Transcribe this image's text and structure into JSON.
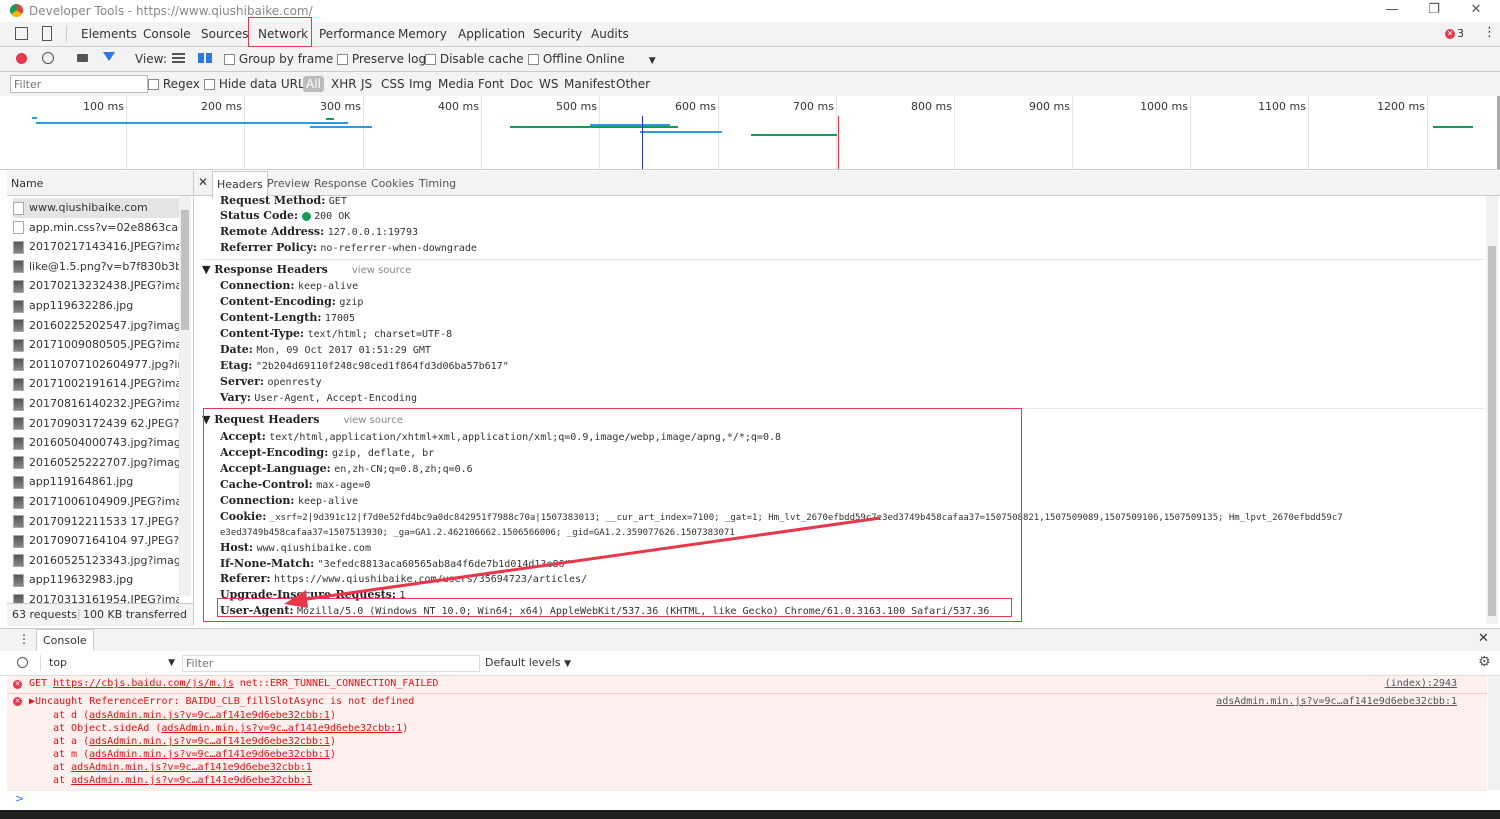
{
  "window": {
    "title": "Developer Tools - https://www.qiushibaike.com/"
  },
  "tabs": [
    "Elements",
    "Console",
    "Sources",
    "Network",
    "Performance",
    "Memory",
    "Application",
    "Security",
    "Audits"
  ],
  "error_count": "3",
  "toolbar": {
    "view_label": "View:",
    "group_by_frame": "Group by frame",
    "preserve_log": "Preserve log",
    "disable_cache": "Disable cache",
    "offline": "Offline",
    "online": "Online"
  },
  "filterbar": {
    "filter_placeholder": "Filter",
    "regex": "Regex",
    "hide_data_urls": "Hide data URLs",
    "types": [
      "All",
      "XHR",
      "JS",
      "CSS",
      "Img",
      "Media",
      "Font",
      "Doc",
      "WS",
      "Manifest",
      "Other"
    ]
  },
  "timeline": {
    "ticks": [
      "100 ms",
      "200 ms",
      "300 ms",
      "400 ms",
      "500 ms",
      "600 ms",
      "700 ms",
      "800 ms",
      "900 ms",
      "1000 ms",
      "1100 ms",
      "1200 ms"
    ]
  },
  "requests": {
    "header": "Name",
    "items": [
      "www.qiushibaike.com",
      "app.min.css?v=02e8863cad2a...",
      "20170217143416.JPEG?image...",
      "like@1.5.png?v=b7f830b3bb9...",
      "20170213232438.JPEG?image...",
      "app119632286.jpg",
      "20160225202547.jpg?imageVi...",
      "20171009080505.JPEG?image...",
      "20110707102604977.jpg?imag...",
      "20171002191614.JPEG?image...",
      "20170816140232.JPEG?image...",
      "20170903172439 62.JPEG?imag...",
      "20160504000743.jpg?imageVi...",
      "20160525222707.jpg?imageVi...",
      "app119164861.jpg",
      "20171006104909.JPEG?image...",
      "20170912211533 17.JPEG?imag...",
      "20170907164104 97.JPEG?imag...",
      "20160525123343.jpg?imageVi...",
      "app119632983.jpg",
      "20170313161954.JPEG?image..."
    ],
    "status": "63 requests",
    "transferred": "100 KB transferred"
  },
  "detail_tabs": [
    "Headers",
    "Preview",
    "Response",
    "Cookies",
    "Timing"
  ],
  "general": [
    {
      "k": "Request Method:",
      "v": "GET"
    },
    {
      "k": "Status Code:",
      "v": "200 OK"
    },
    {
      "k": "Remote Address:",
      "v": "127.0.0.1:19793"
    },
    {
      "k": "Referrer Policy:",
      "v": "no-referrer-when-downgrade"
    }
  ],
  "response_headers": {
    "title": "Response Headers",
    "view_source": "view source",
    "items": [
      {
        "k": "Connection:",
        "v": "keep-alive"
      },
      {
        "k": "Content-Encoding:",
        "v": "gzip"
      },
      {
        "k": "Content-Length:",
        "v": "17005"
      },
      {
        "k": "Content-Type:",
        "v": "text/html; charset=UTF-8"
      },
      {
        "k": "Date:",
        "v": "Mon, 09 Oct 2017 01:51:29 GMT"
      },
      {
        "k": "Etag:",
        "v": "\"2b204d69110f248c98ced1f864fd3d06ba57b617\""
      },
      {
        "k": "Server:",
        "v": "openresty"
      },
      {
        "k": "Vary:",
        "v": "User-Agent, Accept-Encoding"
      }
    ]
  },
  "request_headers": {
    "title": "Request Headers",
    "view_source": "view source",
    "accept": {
      "k": "Accept:",
      "v": "text/html,application/xhtml+xml,application/xml;q=0.9,image/webp,image/apng,*/*;q=0.8"
    },
    "accept_encoding": {
      "k": "Accept-Encoding:",
      "v": "gzip, deflate, br"
    },
    "accept_language": {
      "k": "Accept-Language:",
      "v": "en,zh-CN;q=0.8,zh;q=0.6"
    },
    "cache_control": {
      "k": "Cache-Control:",
      "v": "max-age=0"
    },
    "connection": {
      "k": "Connection:",
      "v": "keep-alive"
    },
    "cookie_k": "Cookie:",
    "cookie_v1": "_xsrf=2|9d391c12|f7d0e52fd4bc9a0dc842951f7988c70a|1507383013; __cur_art_index=7100; _gat=1; Hm_lvt_2670efbdd59c7e3ed3749b458cafaa37=1507508821,1507509089,1507509106,1507509135; Hm_lpvt_2670efbdd59c7",
    "cookie_v2": "e3ed3749b458cafaa37=1507513930; _ga=GA1.2.462106662.1506566006; _gid=GA1.2.359077626.1507383071",
    "host": {
      "k": "Host:",
      "v": "www.qiushibaike.com"
    },
    "if_none_match": {
      "k": "If-None-Match:",
      "v": "\"3efedc8813aca60565ab8a4f6de7b1d014d13e86\""
    },
    "referer": {
      "k": "Referer:",
      "v": "https://www.qiushibaike.com/users/35694723/articles/"
    },
    "upgrade": {
      "k": "Upgrade-Insecure-Requests:",
      "v": "1"
    },
    "user_agent": {
      "k": "User-Agent:",
      "v": "Mozilla/5.0 (Windows NT 10.0; Win64; x64) AppleWebKit/537.36 (KHTML, like Gecko) Chrome/61.0.3163.100 Safari/537.36"
    }
  },
  "console": {
    "tab": "Console",
    "context": "top",
    "filter_placeholder": "Filter",
    "levels": "Default levels",
    "errors": [
      {
        "prefix": "GET ",
        "url": "https://cbjs.baidu.com/js/m.js",
        "msg": " net::ERR_TUNNEL_CONNECTION_FAILED",
        "src": "(index):2943"
      },
      {
        "msg": "▶Uncaught ReferenceError: BAIDU_CLB_fillSlotAsync is not defined",
        "src": "adsAdmin.min.js?v=9c…af141e9d6ebe32cbb:1"
      }
    ],
    "stack": [
      {
        "pre": "at d (",
        "link": "adsAdmin.min.js?v=9c…af141e9d6ebe32cbb:1",
        "post": ")"
      },
      {
        "pre": "at Object.sideAd (",
        "link": "adsAdmin.min.js?v=9c…af141e9d6ebe32cbb:1",
        "post": ")"
      },
      {
        "pre": "at a (",
        "link": "adsAdmin.min.js?v=9c…af141e9d6ebe32cbb:1",
        "post": ")"
      },
      {
        "pre": "at m (",
        "link": "adsAdmin.min.js?v=9c…af141e9d6ebe32cbb:1",
        "post": ")"
      },
      {
        "pre": "at ",
        "link": "adsAdmin.min.js?v=9c…af141e9d6ebe32cbb:1",
        "post": ""
      },
      {
        "pre": "at ",
        "link": "adsAdmin.min.js?v=9c…af141e9d6ebe32cbb:1",
        "post": ""
      }
    ],
    "prompt": ">"
  },
  "colors": {
    "annotation_red": "#e8364a",
    "accent_blue": "#2a7ae2"
  }
}
